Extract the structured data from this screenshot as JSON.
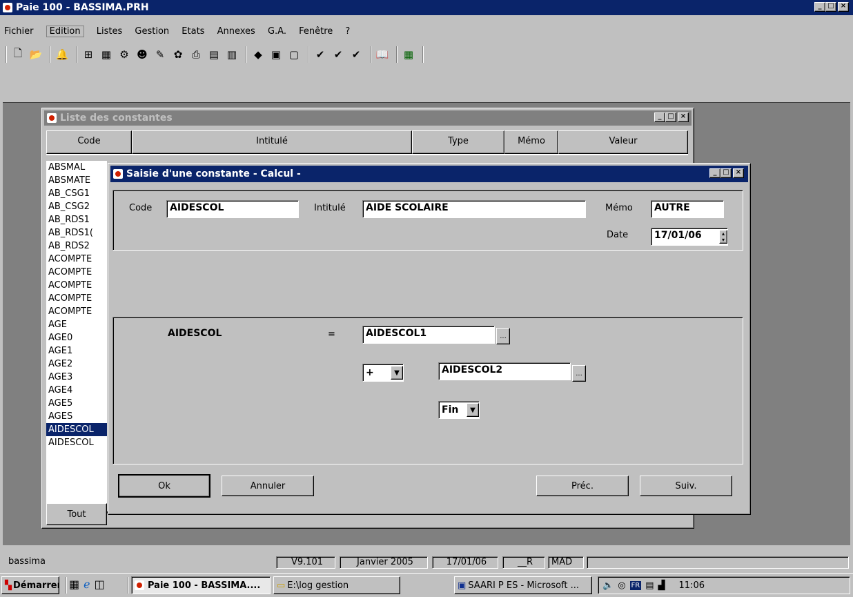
{
  "app": {
    "title": "Paie 100 - BASSIMA.PRH"
  },
  "menu": [
    "Fichier",
    "Edition",
    "Listes",
    "Gestion",
    "Etats",
    "Annexes",
    "G.A.",
    "Fenêtre",
    "?"
  ],
  "toolbar_icons": [
    "new-file-icon",
    "open-folder-icon",
    "bell-icon",
    "tree-icon",
    "calendar-icon",
    "gear-icon",
    "people-icon",
    "tools-icon",
    "chart-icon",
    "print-icon",
    "book-icon",
    "clipboard-icon",
    "list-icon",
    "check-icon",
    "check2-icon",
    "check3-icon",
    "open-book-icon",
    "calculator-icon"
  ],
  "list_window": {
    "title": "Liste des constantes",
    "columns": [
      "Code",
      "Intitulé",
      "Type",
      "Mémo",
      "Valeur"
    ],
    "rows": [
      "ABSMAL",
      "ABSMATE",
      "AB_CSG1",
      "AB_CSG2",
      "AB_RDS1",
      "AB_RDS1(",
      "AB_RDS2",
      "ACOMPTE",
      "ACOMPTE",
      "ACOMPTE",
      "ACOMPTE",
      "ACOMPTE",
      "AGE",
      "AGE0",
      "AGE1",
      "AGE2",
      "AGE3",
      "AGE4",
      "AGE5",
      "AGES",
      "AIDESCOL",
      "AIDESCOL"
    ],
    "selected_row": "AIDESCOL",
    "tout_label": "Tout"
  },
  "dialog": {
    "title": "Saisie d'une constante - Calcul -",
    "code_label": "Code",
    "code_value": "AIDESCOL",
    "intitule_label": "Intitulé",
    "intitule_value": "AIDE SCOLAIRE",
    "memo_label": "Mémo",
    "memo_value": "AUTRE",
    "date_label": "Date",
    "date_value": "17/01/06",
    "formula_name": "AIDESCOL",
    "equals": "=",
    "operand1": "AIDESCOL1",
    "operator": "+",
    "operand2": "AIDESCOL2",
    "end_value": "Fin",
    "browse_label": "...",
    "ok_label": "Ok",
    "cancel_label": "Annuler",
    "prev_label": "Préc.",
    "next_label": "Suiv."
  },
  "status": {
    "user": "bassima",
    "version": "V9.101",
    "period": "Janvier 2005",
    "date": "17/01/06",
    "mode": "__R",
    "currency": "MAD"
  },
  "taskbar": {
    "start_label": "Démarrer",
    "tasks": [
      "Paie 100 - BASSIMA....",
      "E:\\log gestion",
      "SAARI P ES - Microsoft ..."
    ],
    "lang": "FR",
    "clock": "11:06"
  }
}
